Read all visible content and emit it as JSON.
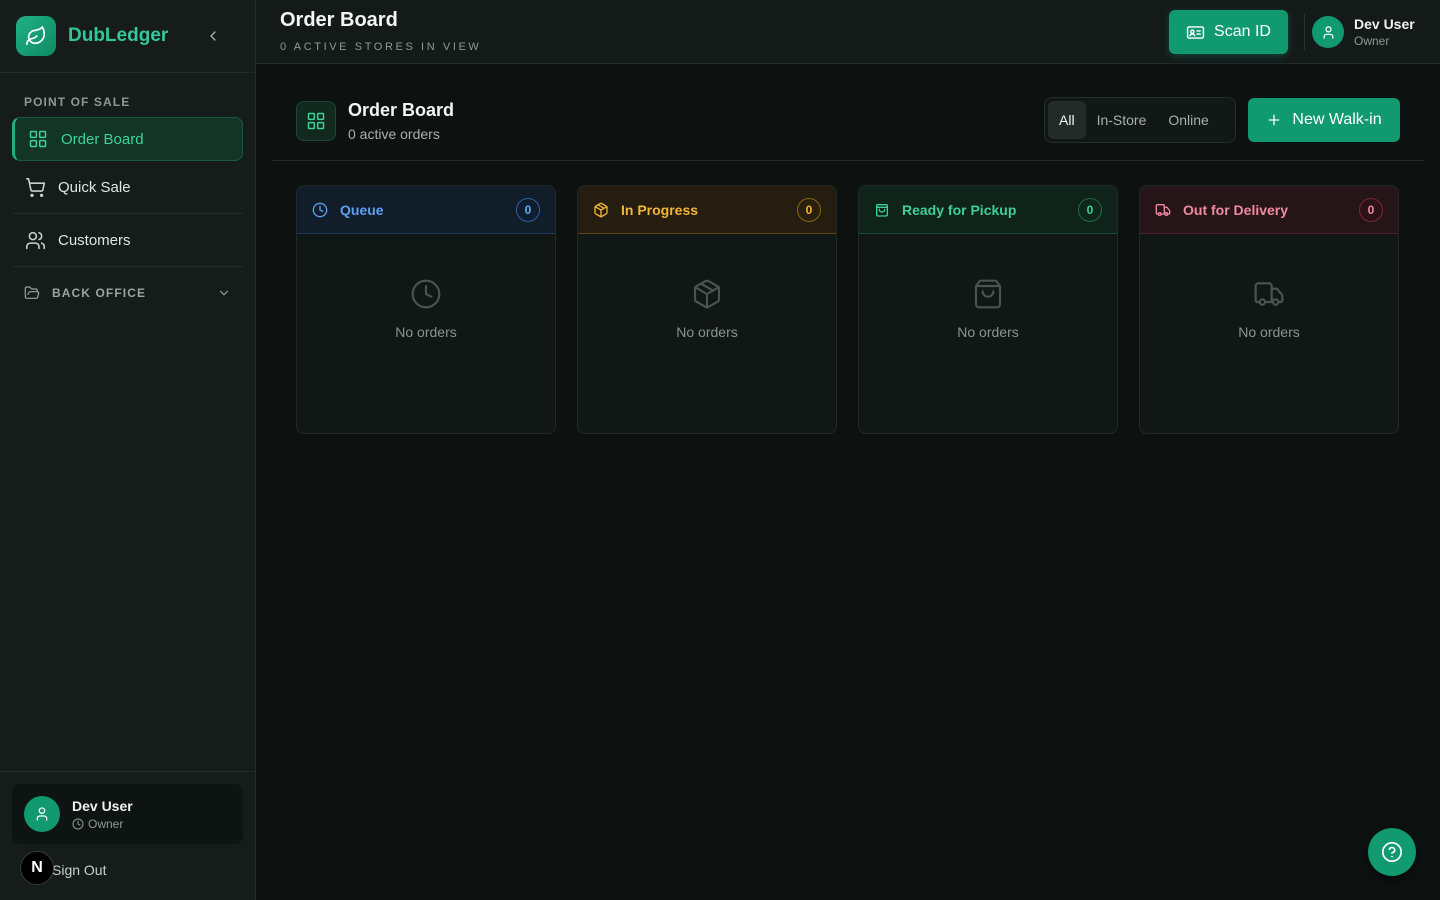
{
  "brand": {
    "name": "DubLedger"
  },
  "sidebar": {
    "section_pos": "POINT OF SALE",
    "items": [
      {
        "label": "Order Board",
        "icon": "grid-icon",
        "active": true
      },
      {
        "label": "Quick Sale",
        "icon": "cart-icon"
      },
      {
        "label": "Customers",
        "icon": "users-icon"
      }
    ],
    "back_office": "BACK OFFICE",
    "user": {
      "name": "Dev User",
      "role": "Owner"
    },
    "sign_out": "Sign Out",
    "n_badge": "N"
  },
  "topbar": {
    "title": "Order Board",
    "subtitle": "0 ACTIVE STORES IN VIEW",
    "scan_label": "Scan ID",
    "user": {
      "name": "Dev User",
      "role": "Owner"
    }
  },
  "board": {
    "title": "Order Board",
    "subtitle": "0 active orders",
    "filters": [
      "All",
      "In-Store",
      "Online"
    ],
    "active_filter": "All",
    "new_walkin": "New Walk-in"
  },
  "columns": [
    {
      "title": "Queue",
      "count": "0",
      "empty": "No orders",
      "color": "#5f9ff0",
      "icon": "clock-icon"
    },
    {
      "title": "In Progress",
      "count": "0",
      "empty": "No orders",
      "color": "#f2b637",
      "icon": "package-icon"
    },
    {
      "title": "Ready for Pickup",
      "count": "0",
      "empty": "No orders",
      "color": "#3ecf9b",
      "icon": "shopping-bag-icon"
    },
    {
      "title": "Out for Delivery",
      "count": "0",
      "empty": "No orders",
      "color": "#f08aa0",
      "icon": "truck-icon"
    }
  ],
  "colors": {
    "accent": "#119a6f",
    "brand_text": "#34c79a",
    "background": "#0d1110",
    "sidebar": "#161c1a"
  }
}
